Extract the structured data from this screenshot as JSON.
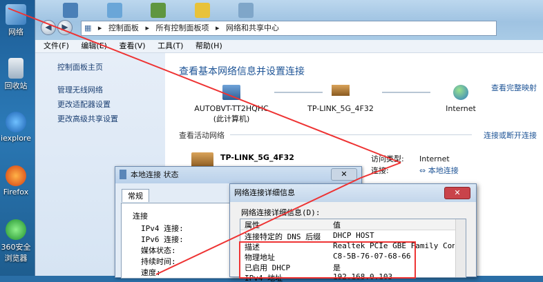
{
  "desktop": {
    "icons": [
      {
        "label": "网络"
      },
      {
        "label": "回收站"
      },
      {
        "label": "iexplore"
      },
      {
        "label": "Firefox"
      },
      {
        "label": "360安全浏览器"
      }
    ]
  },
  "window": {
    "breadcrumb": [
      "控制面板",
      "所有控制面板项",
      "网络和共享中心"
    ],
    "menu": [
      "文件(F)",
      "编辑(E)",
      "查看(V)",
      "工具(T)",
      "帮助(H)"
    ],
    "left_links": [
      "控制面板主页",
      "管理无线网络",
      "更改适配器设置",
      "更改高级共享设置"
    ],
    "heading": "查看基本网络信息并设置连接",
    "see_full_map": "查看完整映射",
    "nodes": [
      {
        "line1": "AUTOBVT-TT2HQHC",
        "line2": "(此计算机)"
      },
      {
        "line1": "TP-LINK_5G_4F32",
        "line2": ""
      },
      {
        "line1": "Internet",
        "line2": ""
      }
    ],
    "active_label": "查看活动网络",
    "connect_link": "连接或断开连接",
    "network_name": "TP-LINK_5G_4F32",
    "access_type_label": "访问类型:",
    "access_type_value": "Internet",
    "connection_label": "连接:",
    "connection_value": "本地连接"
  },
  "status_dialog": {
    "title": "本地连接 状态",
    "tab": "常规",
    "section": "连接",
    "rows": [
      "IPv4 连接:",
      "IPv6 连接:",
      "媒体状态:",
      "持续时间:",
      "速度:"
    ]
  },
  "detail_dialog": {
    "title": "网络连接详细信息",
    "label": "网络连接详细信息(D):",
    "columns": [
      "属性",
      "值"
    ],
    "rows": [
      {
        "prop": "连接特定的 DNS 后缀",
        "value": "DHCP HOST"
      },
      {
        "prop": "描述",
        "value": "Realtek PCIe GBE Family Contro"
      },
      {
        "prop": "物理地址",
        "value": "C8-5B-76-07-68-66"
      },
      {
        "prop": "已启用 DHCP",
        "value": "是"
      },
      {
        "prop": "IPv4 地址",
        "value": "192.168.0.103"
      }
    ]
  },
  "colors": {
    "accent_link": "#1e5496",
    "highlight_red": "#e33333"
  }
}
